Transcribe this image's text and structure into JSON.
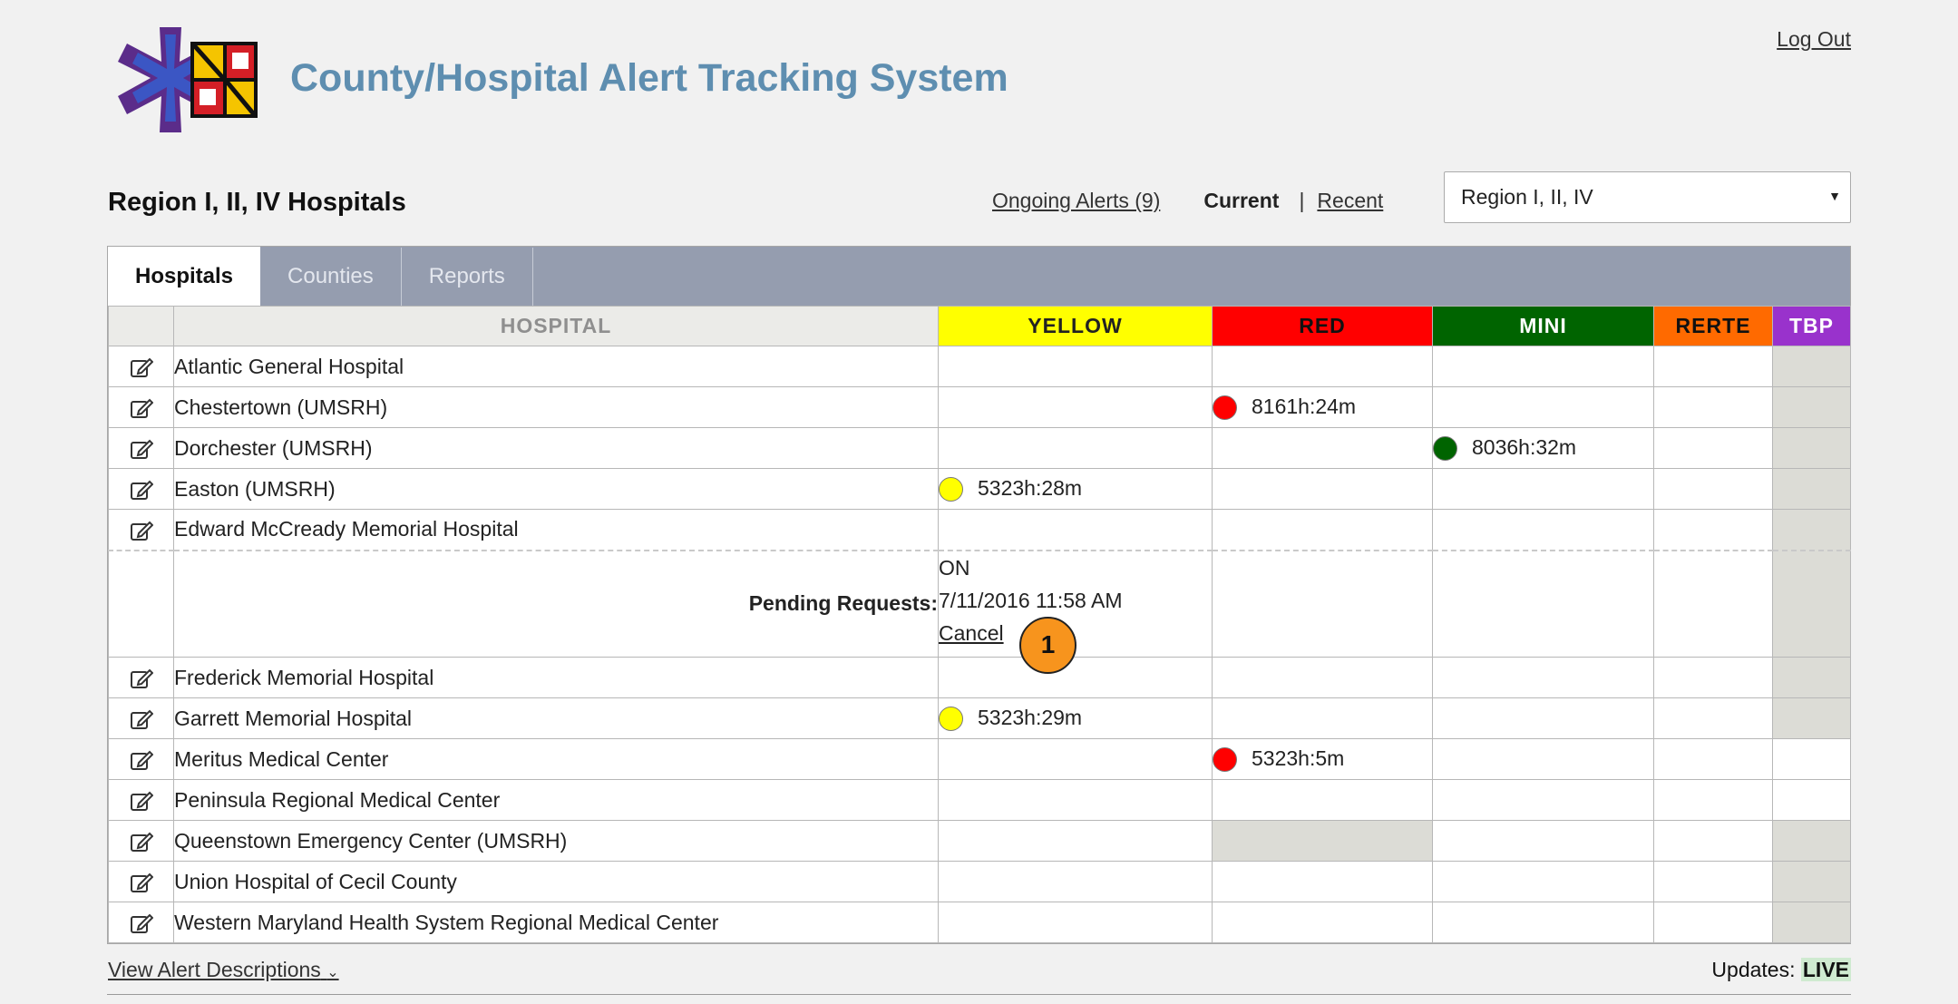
{
  "header": {
    "app_title": "County/Hospital Alert Tracking System",
    "logout_label": "Log Out"
  },
  "page": {
    "region_title": "Region I, II, IV Hospitals",
    "ongoing_alerts_label": "Ongoing Alerts (9)",
    "current_label": "Current",
    "separator": "|",
    "recent_label": "Recent",
    "region_select_value": "Region I, II, IV"
  },
  "tabs": [
    "Hospitals",
    "Counties",
    "Reports"
  ],
  "columns": {
    "hospital": "HOSPITAL",
    "yellow": "YELLOW",
    "red": "RED",
    "mini": "MINI",
    "rerte": "RERTE",
    "tbp": "TBP"
  },
  "colors": {
    "yellow": "#ffff00",
    "red": "#ff0000",
    "mini": "#006400",
    "rerte": "#ff6a00",
    "tbp": "#9932cc",
    "title": "#5e8eb0"
  },
  "rows": [
    {
      "name": "Atlantic General Hospital"
    },
    {
      "name": "Chestertown (UMSRH)",
      "red": "8161h:24m"
    },
    {
      "name": "Dorchester (UMSRH)",
      "mini": "8036h:32m"
    },
    {
      "name": "Easton (UMSRH)",
      "yellow": "5323h:28m"
    },
    {
      "name": "Edward McCready Memorial Hospital"
    },
    {
      "name": "Frederick Memorial Hospital"
    },
    {
      "name": "Garrett Memorial Hospital",
      "yellow": "5323h:29m"
    },
    {
      "name": "Meritus Medical Center",
      "red": "5323h:5m"
    },
    {
      "name": "Peninsula Regional Medical Center"
    },
    {
      "name": "Queenstown Emergency Center (UMSRH)"
    },
    {
      "name": "Union Hospital of Cecil County"
    },
    {
      "name": "Western Maryland Health System Regional Medical Center"
    }
  ],
  "pending": {
    "label": "Pending Requests:",
    "status": "ON",
    "timestamp": "7/11/2016 11:58 AM",
    "cancel_label": "Cancel",
    "marker": "1"
  },
  "footer": {
    "view_descriptions_label": "View Alert Descriptions",
    "updates_label": "Updates:",
    "live_label": "LIVE"
  },
  "icons": [
    "logo-star-of-life-icon",
    "edit-icon",
    "chevron-down-icon",
    "caret-down-icon"
  ]
}
